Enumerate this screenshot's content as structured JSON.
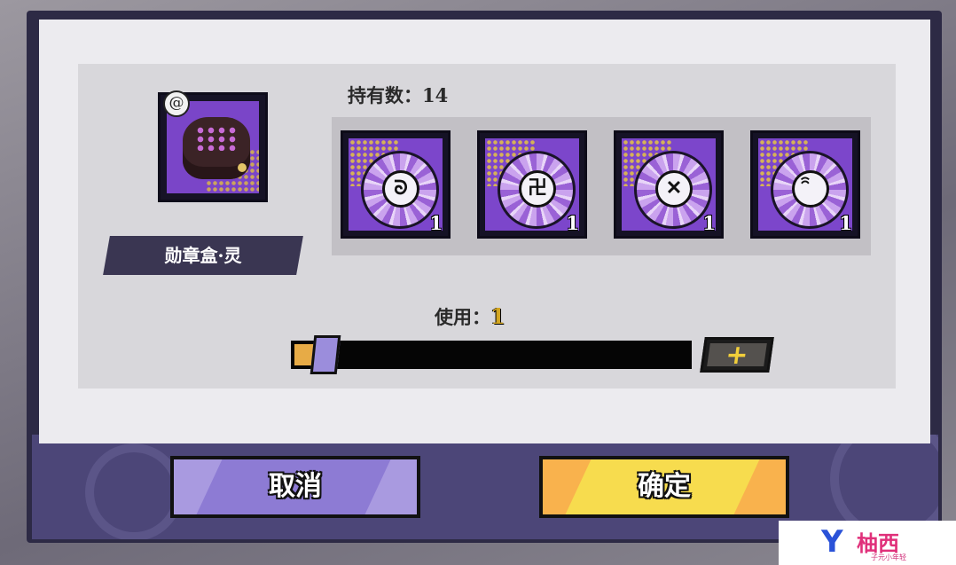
{
  "item": {
    "name": "勋章盒·灵",
    "badge_icon": "swirl-icon"
  },
  "holding": {
    "label": "持有数：14"
  },
  "rewards": [
    {
      "icon": "medal-pattern-a-icon",
      "glyph": "ᘐ",
      "count": "1"
    },
    {
      "icon": "medal-pattern-b-icon",
      "glyph": "卍",
      "count": "1"
    },
    {
      "icon": "medal-pattern-c-icon",
      "glyph": "✕",
      "count": "1"
    },
    {
      "icon": "medal-pattern-d-icon",
      "glyph": "ꩰ",
      "count": "1"
    }
  ],
  "use": {
    "label": "使用：",
    "value": "1",
    "slider_fraction": 0.05
  },
  "plus_button": {
    "label": "+"
  },
  "buttons": {
    "cancel": "取消",
    "confirm": "确定"
  },
  "watermark": {
    "logo": "Y",
    "brand": "柚西",
    "sub": "子元小年轻"
  },
  "colors": {
    "panel_purple": "#4c4678",
    "card_purple": "#7c46cb",
    "accent_yellow": "#f7dc4e",
    "accent_gold": "#d2a520"
  }
}
